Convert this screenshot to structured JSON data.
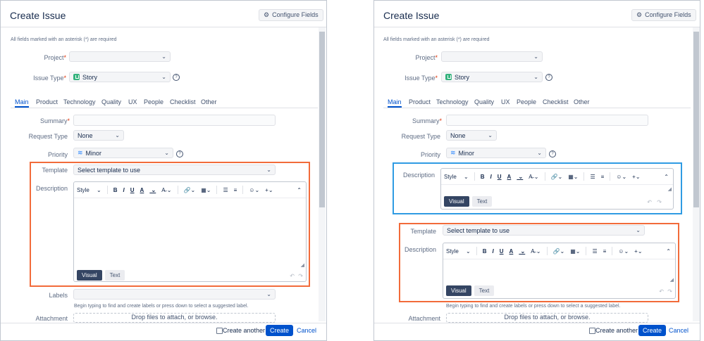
{
  "dialog": {
    "title": "Create Issue",
    "configure_label": "Configure Fields",
    "required_note": "All fields marked with an asterisk (*) are required",
    "project_label": "Project",
    "project_value": "",
    "issue_type_label": "Issue Type",
    "issue_type_value": "Story",
    "tabs": [
      "Main",
      "Product",
      "Technology",
      "Quality",
      "UX",
      "People",
      "Checklist",
      "Other"
    ],
    "summary_label": "Summary",
    "request_type_label": "Request Type",
    "request_type_value": "None",
    "priority_label": "Priority",
    "priority_value": "Minor",
    "template_label": "Template",
    "template_placeholder": "Select template to use",
    "description_label": "Description",
    "toolbar": {
      "style": "Style",
      "bold": "B",
      "italic": "I",
      "underline": "U",
      "text_color": "A"
    },
    "mode_visual": "Visual",
    "mode_text": "Text",
    "labels_label": "Labels",
    "labels_hint": "Begin typing to find and create labels or press down to select a suggested label.",
    "attachment_label": "Attachment",
    "drop_text": "Drop files to attach, or browse.",
    "create_another": "Create another",
    "create_button": "Create",
    "cancel_link": "Cancel"
  },
  "colors": {
    "highlight_orange": "#f26b3a",
    "highlight_blue": "#2f9be3",
    "primary": "#0052cc"
  },
  "icons": [
    "gear-icon",
    "help-icon",
    "story-icon",
    "minor-priority-icon",
    "chevron-down-icon",
    "undo-icon",
    "redo-icon",
    "resize-handle-icon"
  ]
}
